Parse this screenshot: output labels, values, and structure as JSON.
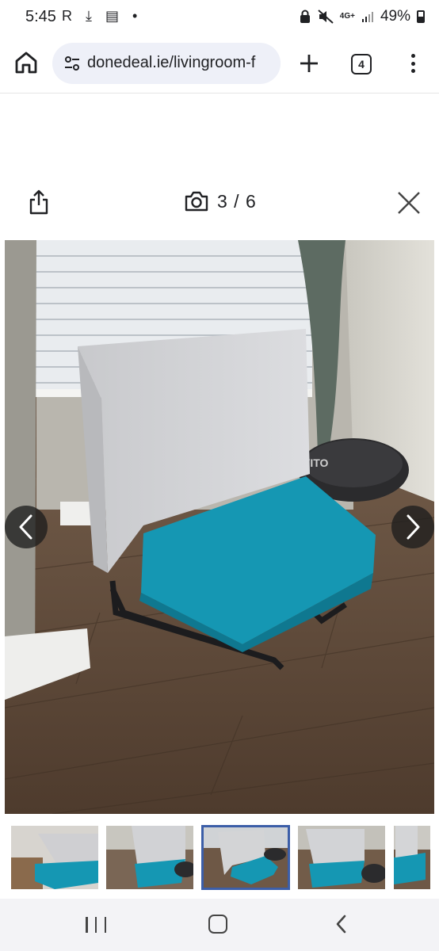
{
  "status_bar": {
    "time": "5:45",
    "left_icons": "R ⤓ ▤ •",
    "network": "4G+",
    "battery": "49%"
  },
  "browser": {
    "url": "donedeal.ie/livingroom-f",
    "tab_count": "4",
    "icons": [
      "home-icon",
      "site-settings-icon",
      "plus-icon",
      "tabs-icon",
      "menu-icon"
    ]
  },
  "gallery": {
    "counter": "3 / 6",
    "current": 3,
    "total": 6,
    "icons": [
      "share-icon",
      "camera-icon",
      "close-icon",
      "chevron-left-icon",
      "chevron-right-icon"
    ]
  },
  "photo": {
    "trampoline_brand": "VITO"
  },
  "thumbnails": {
    "count": 5,
    "active_index": 2
  },
  "android_nav": {
    "icons": [
      "recents-icon",
      "home-nav-icon",
      "back-icon"
    ]
  },
  "colors": {
    "accent_blue": "#3c5ea8",
    "seat_teal": "#1597b3",
    "chair_grey": "#d3d4d6",
    "url_bar": "#eef0f8"
  }
}
